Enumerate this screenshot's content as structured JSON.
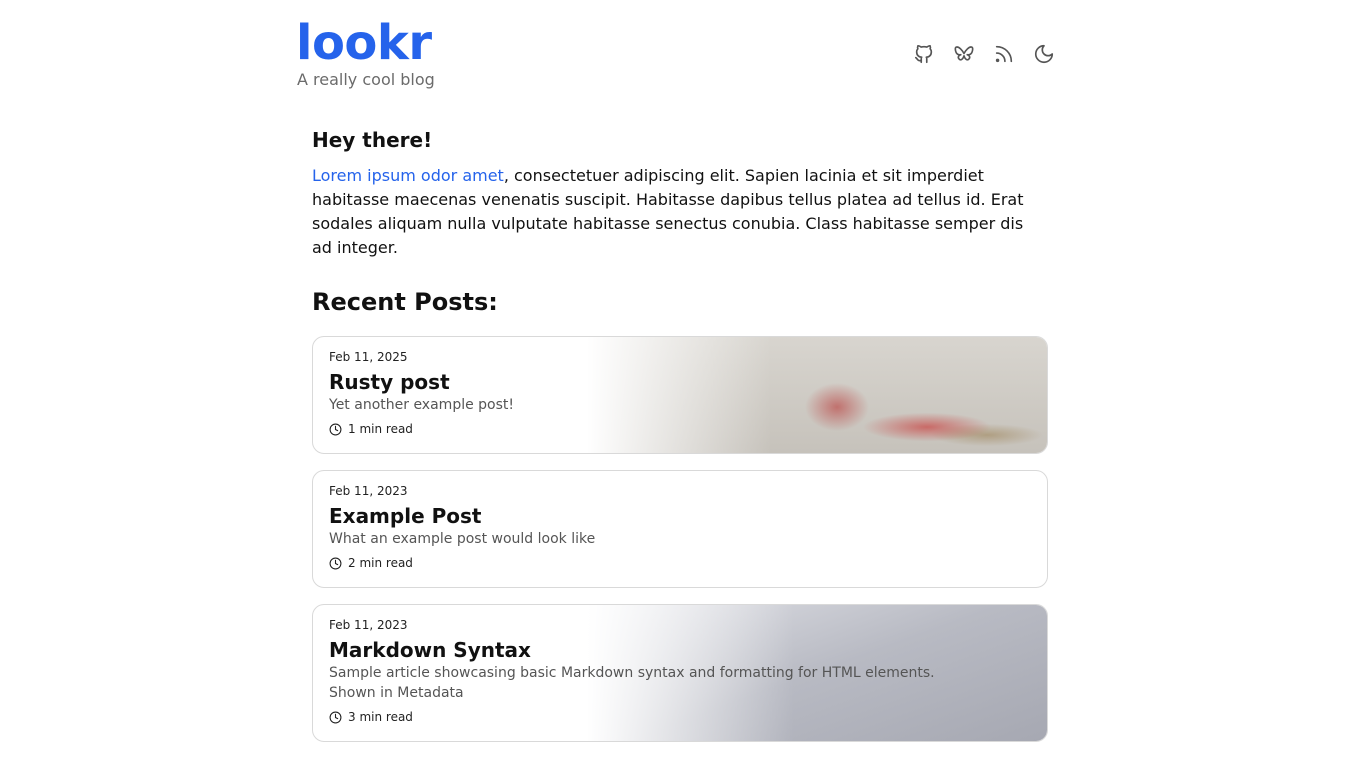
{
  "header": {
    "title": "lookr",
    "tagline": "A really cool blog",
    "icons": [
      "github-icon",
      "bluesky-butterfly-icon",
      "rss-icon",
      "moon-icon"
    ],
    "accent_color": "#2563eb"
  },
  "intro": {
    "heading": "Hey there!",
    "link_text": "Lorem ipsum odor amet",
    "body": ", consectetuer adipiscing elit. Sapien lacinia et sit imperdiet habitasse maecenas venenatis suscipit. Habitasse dapibus tellus platea ad tellus id. Erat sodales aliquam nulla vulputate habitasse senectus conubia. Class habitasse semper dis ad integer."
  },
  "recent": {
    "heading": "Recent Posts:",
    "posts": [
      {
        "date": "Feb 11, 2025",
        "title": "Rusty post",
        "description": "Yet another example post!",
        "read_time": "1 min read"
      },
      {
        "date": "Feb 11, 2023",
        "title": "Example Post",
        "description": "What an example post would look like",
        "read_time": "2 min read"
      },
      {
        "date": "Feb 11, 2023",
        "title": "Markdown Syntax",
        "description": "Sample article showcasing basic Markdown syntax and formatting for HTML elements.",
        "description_2": "Shown in Metadata",
        "read_time": "3 min read"
      }
    ]
  }
}
